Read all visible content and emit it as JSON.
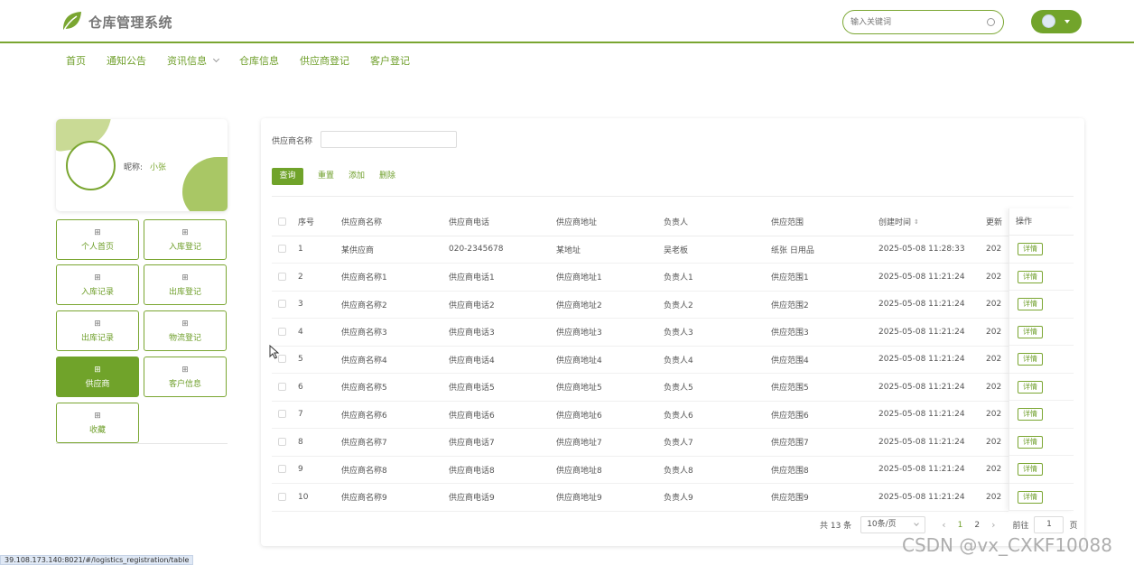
{
  "app": {
    "title": "仓库管理系统"
  },
  "search": {
    "placeholder": "输入关键词"
  },
  "nav": {
    "items": [
      {
        "label": "首页"
      },
      {
        "label": "通知公告"
      },
      {
        "label": "资讯信息",
        "has_dropdown": true
      },
      {
        "label": "仓库信息"
      },
      {
        "label": "供应商登记"
      },
      {
        "label": "客户登记"
      }
    ]
  },
  "profile": {
    "nickname_label": "昵称:",
    "nickname": "小张"
  },
  "menu": {
    "items": [
      {
        "label": "个人首页"
      },
      {
        "label": "入库登记"
      },
      {
        "label": "入库记录"
      },
      {
        "label": "出库登记"
      },
      {
        "label": "出库记录"
      },
      {
        "label": "物流登记"
      },
      {
        "label": "供应商",
        "active": true
      },
      {
        "label": "客户信息"
      },
      {
        "label": "收藏"
      }
    ],
    "icon_glyph": "⊞"
  },
  "filter": {
    "label": "供应商名称",
    "value": ""
  },
  "actions": {
    "query": "查询",
    "reset": "重置",
    "add": "添加",
    "delete": "删除"
  },
  "table": {
    "headers": {
      "index": "序号",
      "name": "供应商名称",
      "phone": "供应商电话",
      "address": "供应商地址",
      "contact": "负责人",
      "scope": "供应范围",
      "created": "创建时间",
      "updated": "更新",
      "ops": "操作"
    },
    "detail_label": "详情",
    "rows": [
      {
        "index": "1",
        "name": "某供应商",
        "phone": "020-2345678",
        "address": "某地址",
        "contact": "吴老板",
        "scope": "纸张 日用品",
        "created": "2025-05-08 11:28:33",
        "updated": "202"
      },
      {
        "index": "2",
        "name": "供应商名称1",
        "phone": "供应商电话1",
        "address": "供应商地址1",
        "contact": "负责人1",
        "scope": "供应范围1",
        "created": "2025-05-08 11:21:24",
        "updated": "202"
      },
      {
        "index": "3",
        "name": "供应商名称2",
        "phone": "供应商电话2",
        "address": "供应商地址2",
        "contact": "负责人2",
        "scope": "供应范围2",
        "created": "2025-05-08 11:21:24",
        "updated": "202"
      },
      {
        "index": "4",
        "name": "供应商名称3",
        "phone": "供应商电话3",
        "address": "供应商地址3",
        "contact": "负责人3",
        "scope": "供应范围3",
        "created": "2025-05-08 11:21:24",
        "updated": "202"
      },
      {
        "index": "5",
        "name": "供应商名称4",
        "phone": "供应商电话4",
        "address": "供应商地址4",
        "contact": "负责人4",
        "scope": "供应范围4",
        "created": "2025-05-08 11:21:24",
        "updated": "202"
      },
      {
        "index": "6",
        "name": "供应商名称5",
        "phone": "供应商电话5",
        "address": "供应商地址5",
        "contact": "负责人5",
        "scope": "供应范围5",
        "created": "2025-05-08 11:21:24",
        "updated": "202"
      },
      {
        "index": "7",
        "name": "供应商名称6",
        "phone": "供应商电话6",
        "address": "供应商地址6",
        "contact": "负责人6",
        "scope": "供应范围6",
        "created": "2025-05-08 11:21:24",
        "updated": "202"
      },
      {
        "index": "8",
        "name": "供应商名称7",
        "phone": "供应商电话7",
        "address": "供应商地址7",
        "contact": "负责人7",
        "scope": "供应范围7",
        "created": "2025-05-08 11:21:24",
        "updated": "202"
      },
      {
        "index": "9",
        "name": "供应商名称8",
        "phone": "供应商电话8",
        "address": "供应商地址8",
        "contact": "负责人8",
        "scope": "供应范围8",
        "created": "2025-05-08 11:21:24",
        "updated": "202"
      },
      {
        "index": "10",
        "name": "供应商名称9",
        "phone": "供应商电话9",
        "address": "供应商地址9",
        "contact": "负责人9",
        "scope": "供应范围9",
        "created": "2025-05-08 11:21:24",
        "updated": "202"
      }
    ]
  },
  "pagination": {
    "total": "共 13 条",
    "page_size": "10条/页",
    "prev": "‹",
    "next": "›",
    "pages": [
      "1",
      "2"
    ],
    "current_page": "1",
    "goto_label": "前往",
    "goto_value": "1",
    "goto_unit": "页"
  },
  "statusbar": {
    "url": "39.108.173.140:8021/#/logistics_registration/table"
  },
  "watermark": {
    "text": "CSDN @vx_CXKF10088"
  },
  "colors": {
    "accent": "#70a32a",
    "header_rule": "#7aa631"
  }
}
